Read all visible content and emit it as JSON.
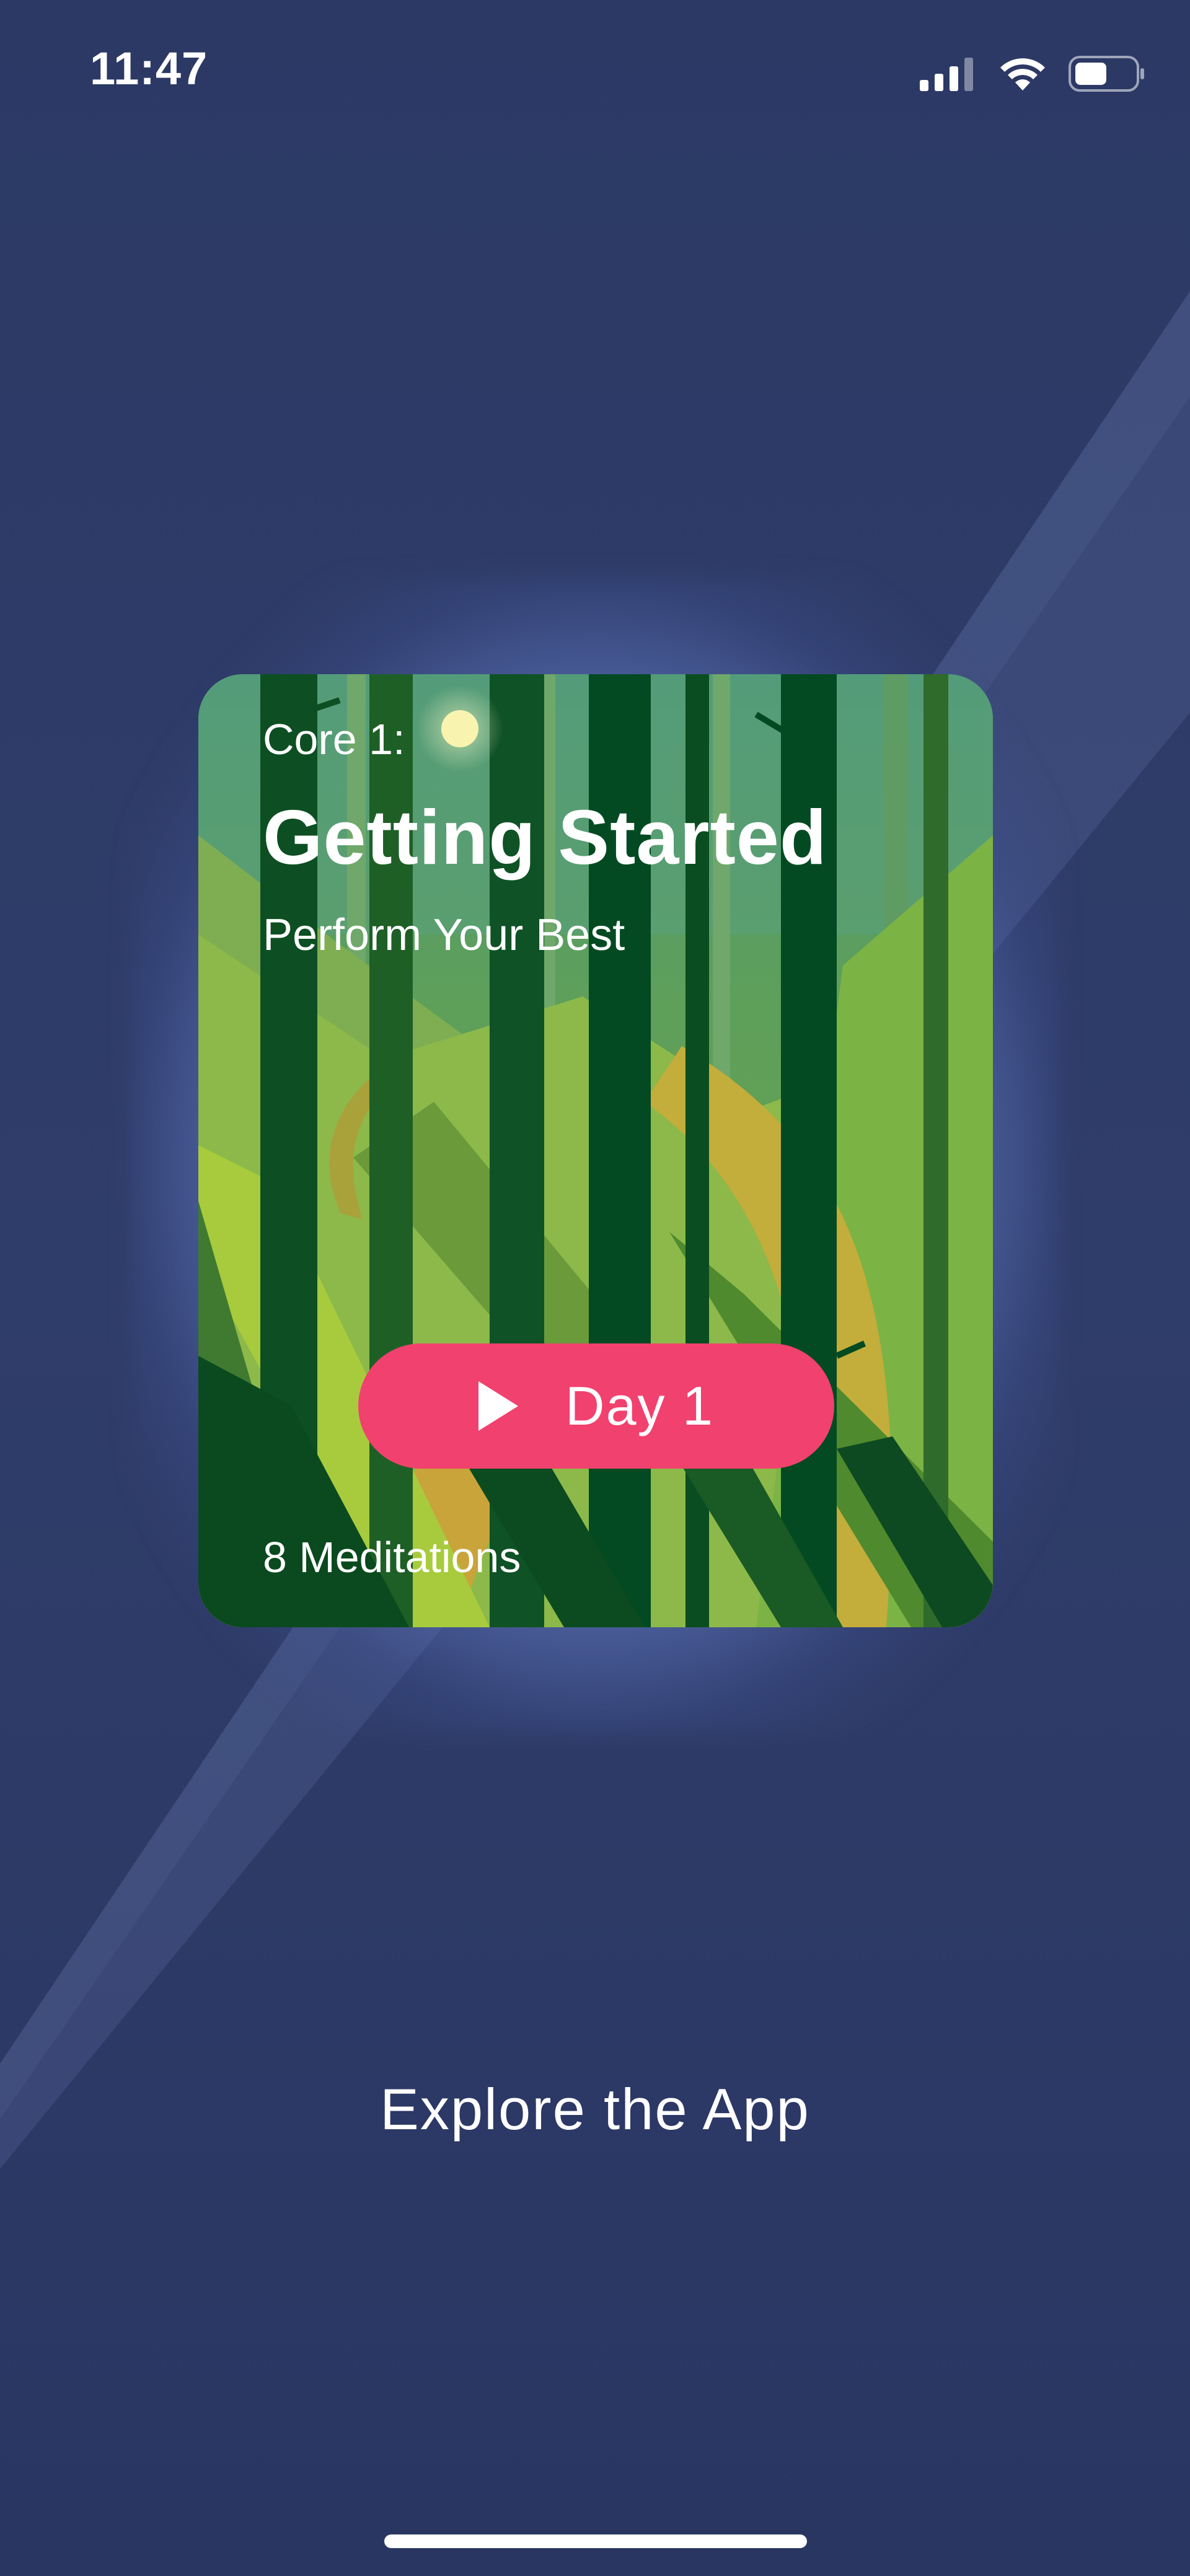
{
  "status_bar": {
    "time": "11:47",
    "icons": [
      "cellular-signal-icon",
      "wifi-icon",
      "battery-icon"
    ]
  },
  "card": {
    "eyebrow": "Core 1:",
    "title": "Getting Started",
    "subtitle": "Perform Your Best",
    "play_button_label": "Day 1",
    "play_icon": "play-icon",
    "count_label": "8 Meditations"
  },
  "explore_link": "Explore the App",
  "colors": {
    "background": "#2c3965",
    "accent": "#f1416e",
    "forest_dark": "#034a22",
    "forest_light": "#8cbf43",
    "path": "#c9a73a"
  }
}
